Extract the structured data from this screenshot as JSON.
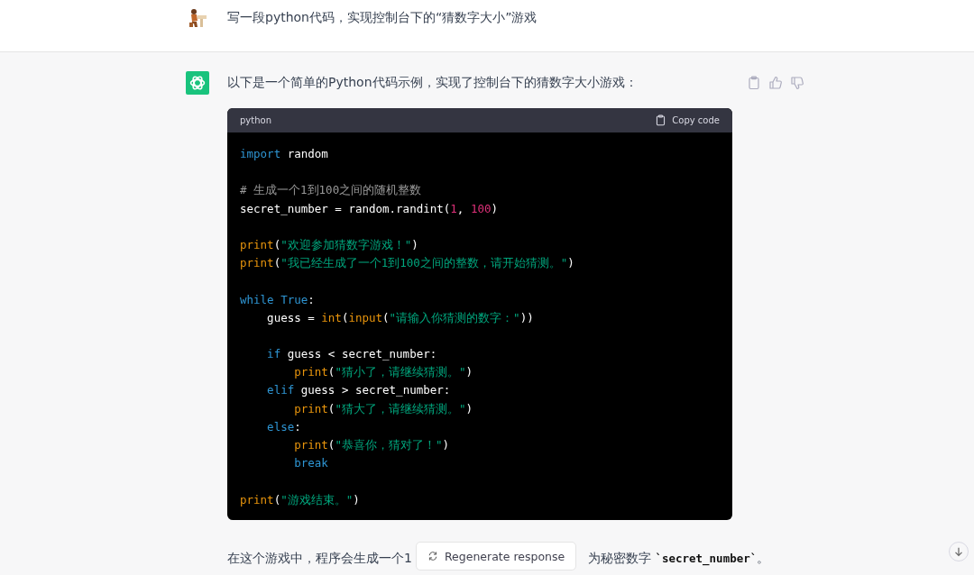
{
  "user_message": {
    "text": "写一段python代码，实现控制台下的“猜数字大小”游戏"
  },
  "assistant_message": {
    "intro": "以下是一个简单的Python代码示例，实现了控制台下的猜数字大小游戏：",
    "code_block": {
      "language": "python",
      "copy_label": "Copy code",
      "lines": [
        {
          "kind": "code",
          "tokens": [
            {
              "kind": "keyword",
              "text": "import"
            },
            {
              "kind": "plain",
              "text": " random"
            }
          ]
        },
        {
          "kind": "blank"
        },
        {
          "kind": "code",
          "tokens": [
            {
              "kind": "comment",
              "text": "# 生成一个1到100之间的随机整数"
            }
          ]
        },
        {
          "kind": "code",
          "tokens": [
            {
              "kind": "plain",
              "text": "secret_number = random.randint("
            },
            {
              "kind": "number",
              "text": "1"
            },
            {
              "kind": "plain",
              "text": ", "
            },
            {
              "kind": "number",
              "text": "100"
            },
            {
              "kind": "plain",
              "text": ")"
            }
          ]
        },
        {
          "kind": "blank"
        },
        {
          "kind": "code",
          "tokens": [
            {
              "kind": "builtin",
              "text": "print"
            },
            {
              "kind": "plain",
              "text": "("
            },
            {
              "kind": "string",
              "text": "\"欢迎参加猜数字游戏！\""
            },
            {
              "kind": "plain",
              "text": ")"
            }
          ]
        },
        {
          "kind": "code",
          "tokens": [
            {
              "kind": "builtin",
              "text": "print"
            },
            {
              "kind": "plain",
              "text": "("
            },
            {
              "kind": "string",
              "text": "\"我已经生成了一个1到100之间的整数，请开始猜测。\""
            },
            {
              "kind": "plain",
              "text": ")"
            }
          ]
        },
        {
          "kind": "blank"
        },
        {
          "kind": "code",
          "tokens": [
            {
              "kind": "keyword",
              "text": "while"
            },
            {
              "kind": "keyword",
              "text": " True"
            },
            {
              "kind": "plain",
              "text": ":"
            }
          ]
        },
        {
          "kind": "code",
          "tokens": [
            {
              "kind": "plain",
              "text": "    guess = "
            },
            {
              "kind": "builtin",
              "text": "int"
            },
            {
              "kind": "plain",
              "text": "("
            },
            {
              "kind": "builtin",
              "text": "input"
            },
            {
              "kind": "plain",
              "text": "("
            },
            {
              "kind": "string",
              "text": "\"请输入你猜测的数字：\""
            },
            {
              "kind": "plain",
              "text": "))"
            }
          ]
        },
        {
          "kind": "blank"
        },
        {
          "kind": "code",
          "tokens": [
            {
              "kind": "keyword",
              "text": "    if"
            },
            {
              "kind": "plain",
              "text": " guess < secret_number:"
            }
          ]
        },
        {
          "kind": "code",
          "tokens": [
            {
              "kind": "builtin",
              "text": "        print"
            },
            {
              "kind": "plain",
              "text": "("
            },
            {
              "kind": "string",
              "text": "\"猜小了，请继续猜测。\""
            },
            {
              "kind": "plain",
              "text": ")"
            }
          ]
        },
        {
          "kind": "code",
          "tokens": [
            {
              "kind": "keyword",
              "text": "    elif"
            },
            {
              "kind": "plain",
              "text": " guess > secret_number:"
            }
          ]
        },
        {
          "kind": "code",
          "tokens": [
            {
              "kind": "builtin",
              "text": "        print"
            },
            {
              "kind": "plain",
              "text": "("
            },
            {
              "kind": "string",
              "text": "\"猜大了，请继续猜测。\""
            },
            {
              "kind": "plain",
              "text": ")"
            }
          ]
        },
        {
          "kind": "code",
          "tokens": [
            {
              "kind": "keyword",
              "text": "    else"
            },
            {
              "kind": "plain",
              "text": ":"
            }
          ]
        },
        {
          "kind": "code",
          "tokens": [
            {
              "kind": "builtin",
              "text": "        print"
            },
            {
              "kind": "plain",
              "text": "("
            },
            {
              "kind": "string",
              "text": "\"恭喜你，猜对了！\""
            },
            {
              "kind": "plain",
              "text": ")"
            }
          ]
        },
        {
          "kind": "code",
          "tokens": [
            {
              "kind": "keyword",
              "text": "        break"
            }
          ]
        },
        {
          "kind": "blank"
        },
        {
          "kind": "code",
          "tokens": [
            {
              "kind": "builtin",
              "text": "print"
            },
            {
              "kind": "plain",
              "text": "("
            },
            {
              "kind": "string",
              "text": "\"游戏结束。\""
            },
            {
              "kind": "plain",
              "text": ")"
            }
          ]
        }
      ]
    },
    "paragraph": {
      "start": "在这个游戏中，程序会生成一个1",
      "end": "为秘密数字 ",
      "code": "`secret_number`",
      "tail": "。"
    }
  },
  "regenerate_button": {
    "label": "Regenerate response"
  }
}
